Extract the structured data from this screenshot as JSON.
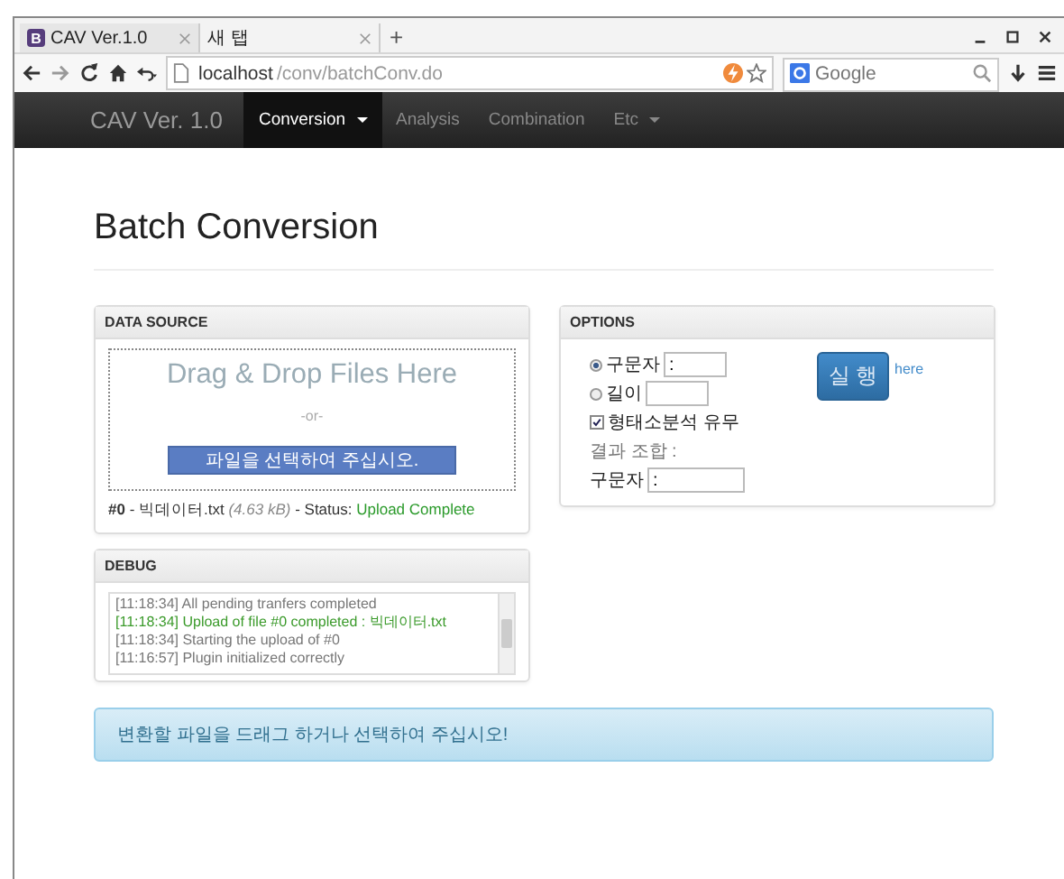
{
  "browser": {
    "tabs": [
      {
        "title": "CAV Ver.1.0",
        "selected": true,
        "favicon": "B"
      },
      {
        "title": "새 탭",
        "selected": false
      }
    ],
    "new_tab": "+",
    "url_host": "localhost",
    "url_path": "/conv/batchConv.do",
    "search_placeholder": "Google"
  },
  "navbar": {
    "brand": "CAV Ver. 1.0",
    "items": [
      {
        "label": "Conversion",
        "selected": true,
        "dropdown": true
      },
      {
        "label": "Analysis",
        "selected": false,
        "dropdown": false
      },
      {
        "label": "Combination",
        "selected": false,
        "dropdown": false
      },
      {
        "label": "Etc",
        "selected": false,
        "dropdown": true
      }
    ]
  },
  "heading": "Batch Conversion",
  "data_source": {
    "title": "DATA SOURCE",
    "drop_text": "Drag & Drop Files Here",
    "or_text": "-or-",
    "button": "파일을 선택하여 주십시오.",
    "file": {
      "index": "#0",
      "separator": "-",
      "name": "빅데이터.txt",
      "size": "(4.63 kB)",
      "status_label": "- Status:",
      "status": "Upload Complete"
    }
  },
  "options": {
    "title": "OPTIONS",
    "radios": [
      {
        "label": "구문자",
        "value": ":",
        "selected": true
      },
      {
        "label": "길이",
        "selected": false
      }
    ],
    "checkbox": {
      "label": "형태소분석 유무",
      "checked": true
    },
    "result_label": "결과 조합 :",
    "result_field": {
      "label": "구문자",
      "value": ":"
    },
    "run_button": "실 행",
    "link": "here"
  },
  "debug": {
    "title": "DEBUG",
    "lines": [
      {
        "text": "[11:18:34] All pending tranfers completed",
        "kind": "normal"
      },
      {
        "text": "[11:18:34] Upload of file #0 completed : 빅데이터.txt",
        "kind": "success"
      },
      {
        "text": "[11:18:34] Starting the upload of #0",
        "kind": "normal"
      },
      {
        "text": "[11:16:57] Plugin initialized correctly",
        "kind": "normal"
      }
    ]
  },
  "alert": "변환할 파일을 드래그 하거나 선택하여 주십시오!"
}
